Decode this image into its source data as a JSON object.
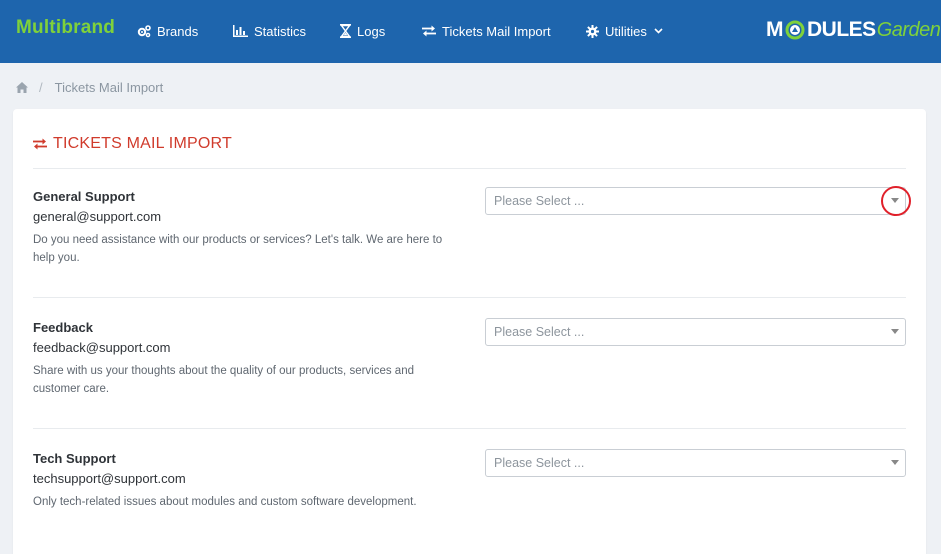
{
  "app": {
    "title": "Multibrand"
  },
  "nav": {
    "brands": "Brands",
    "statistics": "Statistics",
    "logs": "Logs",
    "tickets_mail_import": "Tickets Mail Import",
    "utilities": "Utilities"
  },
  "logo": {
    "part1": "M",
    "part2": "DULES",
    "part3": "Garden"
  },
  "breadcrumb": {
    "current": "Tickets Mail Import"
  },
  "panel": {
    "title": "TICKETS MAIL IMPORT"
  },
  "departments": [
    {
      "name": "General Support",
      "email": "general@support.com",
      "description": "Do you need assistance with our products or services? Let's talk. We are here to help you.",
      "select_placeholder": "Please Select ..."
    },
    {
      "name": "Feedback",
      "email": "feedback@support.com",
      "description": "Share with us your thoughts about the quality of our products, services and customer care.",
      "select_placeholder": "Please Select ..."
    },
    {
      "name": "Tech Support",
      "email": "techsupport@support.com",
      "description": "Only tech-related issues about modules and custom software development.",
      "select_placeholder": "Please Select ..."
    }
  ],
  "colors": {
    "topbar": "#1e65ad",
    "brand": "#7fd13b",
    "title": "#d03b2c",
    "highlight": "#e0202a"
  }
}
